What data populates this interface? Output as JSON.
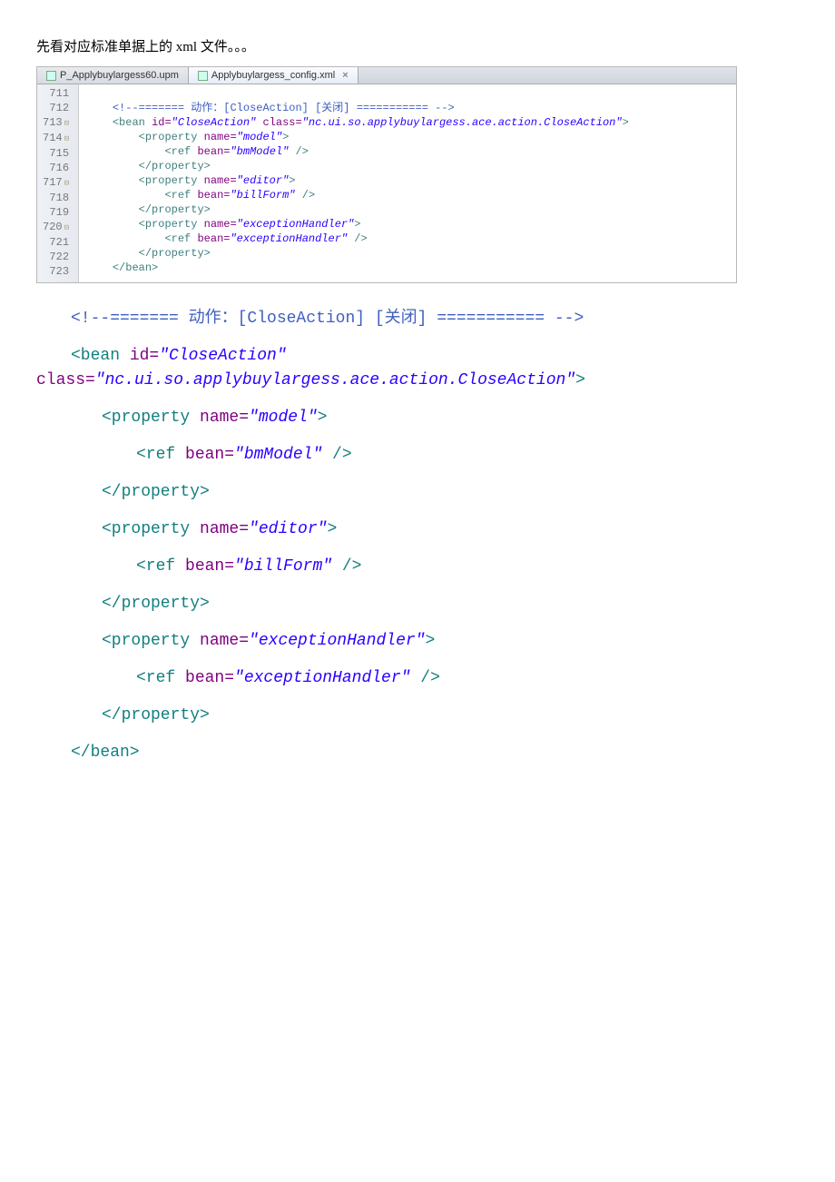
{
  "intro": "先看对应标准单据上的 xml 文件。。。",
  "tabs": {
    "inactive": "P_Applybuylargess60.upm",
    "active": "Applybuylargess_config.xml"
  },
  "gutter": [
    "711",
    "712",
    "713",
    "714",
    "715",
    "716",
    "717",
    "718",
    "719",
    "720",
    "721",
    "722",
    "723"
  ],
  "code": {
    "cmt_open": "<!--======= ",
    "cmt_label": "动作：[CloseAction] [关闭]",
    "cmt_close": " =========== -->",
    "bean_open_1": "<bean ",
    "id_attr": "id=",
    "id_val": "\"CloseAction\"",
    "class_attr": " class=",
    "class_val": "\"nc.ui.so.applybuylargess.ace.action.CloseAction\"",
    "close_gt": ">",
    "prop_open": "<property ",
    "name_attr": "name=",
    "model_val": "\"model\"",
    "editor_val": "\"editor\"",
    "exc_val": "\"exceptionHandler\"",
    "ref_open": "<ref ",
    "bean_attr": "bean=",
    "bm_val": "\"bmModel\"",
    "bill_val": "\"billForm\"",
    "exch_val": "\"exceptionHandler\"",
    "self_close": " />",
    "prop_close": "</property>",
    "bean_close": "</bean>"
  }
}
